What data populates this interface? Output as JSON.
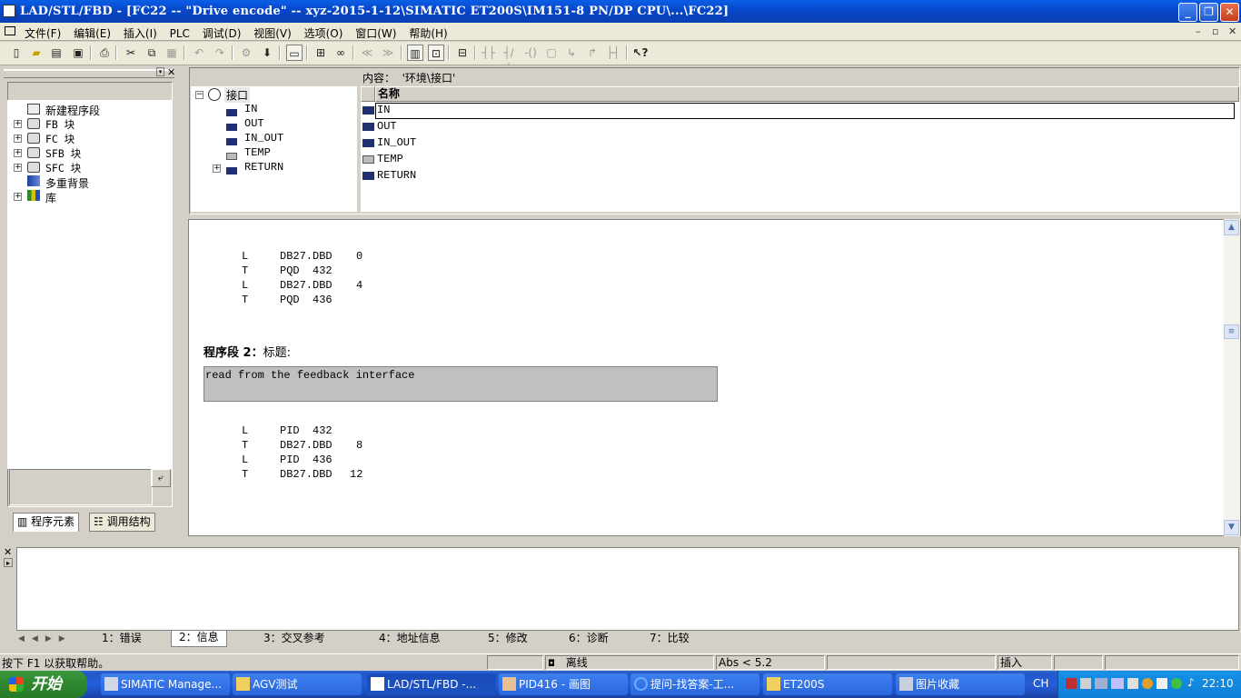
{
  "window": {
    "title": "LAD/STL/FBD  - [FC22 -- \"Drive encode\" -- xyz-2015-1-12\\SIMATIC ET200S\\IM151-8 PN/DP CPU\\...\\FC22]",
    "minimize": "_",
    "restore": "❐",
    "close": "✕"
  },
  "menubar": {
    "items": [
      "文件(F)",
      "编辑(E)",
      "插入(I)",
      "PLC",
      "调试(D)",
      "视图(V)",
      "选项(O)",
      "窗口(W)",
      "帮助(H)"
    ]
  },
  "left_pane": {
    "tree": [
      {
        "label": "新建程序段",
        "expandable": false
      },
      {
        "label": "FB 块",
        "expandable": true
      },
      {
        "label": "FC 块",
        "expandable": true
      },
      {
        "label": "SFB 块",
        "expandable": true
      },
      {
        "label": "SFC 块",
        "expandable": true
      },
      {
        "label": "多重背景",
        "expandable": false
      },
      {
        "label": "库",
        "expandable": true
      }
    ],
    "tabs": [
      "程序元素",
      "调用结构"
    ]
  },
  "interface": {
    "content_label": "内容：  '环境\\接口'",
    "root": "接口",
    "tree": [
      "IN",
      "OUT",
      "IN_OUT",
      "TEMP",
      "RETURN"
    ],
    "column_header": "名称",
    "rows": [
      "IN",
      "OUT",
      "IN_OUT",
      "TEMP",
      "RETURN"
    ]
  },
  "code": {
    "block1": [
      {
        "op": "L",
        "operand": "DB27.DBD",
        "val": "0"
      },
      {
        "op": "T",
        "operand": "PQD  432",
        "val": ""
      },
      {
        "op": "L",
        "operand": "DB27.DBD",
        "val": "4"
      },
      {
        "op": "T",
        "operand": "PQD  436",
        "val": ""
      }
    ],
    "network2_title": "程序段  2：",
    "network2_title_suffix": "标题:",
    "network2_comment": "read from the feedback interface",
    "block2": [
      {
        "op": "L",
        "operand": "PID  432",
        "val": ""
      },
      {
        "op": "T",
        "operand": "DB27.DBD",
        "val": "8"
      },
      {
        "op": "L",
        "operand": "PID  436",
        "val": ""
      },
      {
        "op": "T",
        "operand": "DB27.DBD",
        "val": "12"
      }
    ]
  },
  "output_tabs": [
    "1：错误",
    "2：信息",
    "3：交叉参考",
    "4：地址信息",
    "5：修改",
    "6：诊断",
    "7：比较"
  ],
  "status": {
    "help": "按下 F1 以获取帮助。",
    "mode": "离线",
    "abs": "Abs < 5.2",
    "insert": "插入"
  },
  "taskbar": {
    "start": "开始",
    "tasks": [
      "SIMATIC Manage...",
      "AGV测试",
      "LAD/STL/FBD  -...",
      "PID416 - 画图",
      "提问-找答案-工...",
      "ET200S",
      "图片收藏"
    ],
    "lang": "CH",
    "clock": "22:10"
  }
}
